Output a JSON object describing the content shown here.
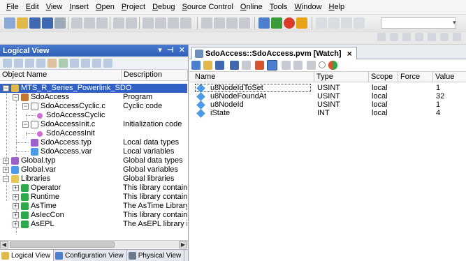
{
  "menu": [
    "File",
    "Edit",
    "View",
    "Insert",
    "Open",
    "Project",
    "Debug",
    "Source Control",
    "Online",
    "Tools",
    "Window",
    "Help"
  ],
  "left_panel": {
    "title": "Logical View",
    "header_buttons": [
      "▾",
      "⊣",
      "✕"
    ],
    "columns": [
      "Object Name",
      "Description"
    ],
    "tree": [
      {
        "name": "MTS_R_Series_Powerlink_SDO",
        "desc": "",
        "icon": "project-icon",
        "selected": true
      },
      {
        "name": "SdoAccess",
        "desc": "Program",
        "icon": "program-icon"
      },
      {
        "name": "SdoAccessCyclic.c",
        "desc": "Cyclic code",
        "icon": "c-file-icon"
      },
      {
        "name": "SdoAccessCyclic",
        "desc": "",
        "icon": "function-icon"
      },
      {
        "name": "SdoAccessInit.c",
        "desc": "Initialization code",
        "icon": "c-file-icon"
      },
      {
        "name": "SdoAccessInit",
        "desc": "",
        "icon": "function-icon"
      },
      {
        "name": "SdoAccess.typ",
        "desc": "Local data types",
        "icon": "type-file-icon"
      },
      {
        "name": "SdoAccess.var",
        "desc": "Local variables",
        "icon": "var-file-icon"
      },
      {
        "name": "Global.typ",
        "desc": "Global data types",
        "icon": "type-file-icon"
      },
      {
        "name": "Global.var",
        "desc": "Global variables",
        "icon": "var-file-icon"
      },
      {
        "name": "Libraries",
        "desc": "Global libraries",
        "icon": "folder-icon"
      },
      {
        "name": "Operator",
        "desc": "This library contains fur",
        "icon": "library-icon"
      },
      {
        "name": "Runtime",
        "desc": "This library contains rur",
        "icon": "library-icon"
      },
      {
        "name": "AsTime",
        "desc": "The AsTime Library sup",
        "icon": "library-icon"
      },
      {
        "name": "AsIecCon",
        "desc": "This library contains fur",
        "icon": "library-icon"
      },
      {
        "name": "AsEPL",
        "desc": "The AsEPL library is use",
        "icon": "library-icon"
      }
    ],
    "bottom_tabs": [
      "Logical View",
      "Configuration View",
      "Physical View"
    ]
  },
  "watch": {
    "tab_title": "SdoAccess::SdoAccess.pvm [Watch]",
    "tab_close": "×",
    "columns": [
      "Name",
      "Type",
      "Scope",
      "Force",
      "Value"
    ],
    "rows": [
      {
        "name": "u8NodeIdToSet",
        "type": "USINT",
        "scope": "local",
        "force": "",
        "value": "1"
      },
      {
        "name": "u8NodeFoundAt",
        "type": "USINT",
        "scope": "local",
        "force": "",
        "value": "32"
      },
      {
        "name": "u8NodeId",
        "type": "USINT",
        "scope": "local",
        "force": "",
        "value": "1"
      },
      {
        "name": "iState",
        "type": "INT",
        "scope": "local",
        "force": "",
        "value": "4"
      }
    ]
  },
  "colors": {
    "panel_header": "#2e5fb6",
    "selection": "#3161c4",
    "var_icon": "#4d9be6"
  }
}
